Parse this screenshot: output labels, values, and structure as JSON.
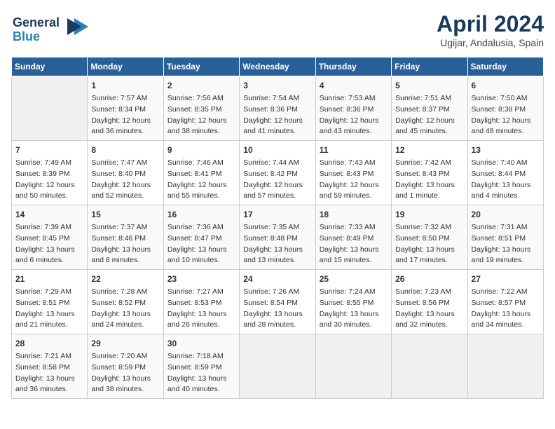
{
  "header": {
    "logo_line1": "General",
    "logo_line2": "Blue",
    "month_title": "April 2024",
    "location": "Ugijar, Andalusia, Spain"
  },
  "weekdays": [
    "Sunday",
    "Monday",
    "Tuesday",
    "Wednesday",
    "Thursday",
    "Friday",
    "Saturday"
  ],
  "weeks": [
    [
      {
        "day": "",
        "sunrise": "",
        "sunset": "",
        "daylight": ""
      },
      {
        "day": "1",
        "sunrise": "Sunrise: 7:57 AM",
        "sunset": "Sunset: 8:34 PM",
        "daylight": "Daylight: 12 hours and 36 minutes."
      },
      {
        "day": "2",
        "sunrise": "Sunrise: 7:56 AM",
        "sunset": "Sunset: 8:35 PM",
        "daylight": "Daylight: 12 hours and 38 minutes."
      },
      {
        "day": "3",
        "sunrise": "Sunrise: 7:54 AM",
        "sunset": "Sunset: 8:36 PM",
        "daylight": "Daylight: 12 hours and 41 minutes."
      },
      {
        "day": "4",
        "sunrise": "Sunrise: 7:53 AM",
        "sunset": "Sunset: 8:36 PM",
        "daylight": "Daylight: 12 hours and 43 minutes."
      },
      {
        "day": "5",
        "sunrise": "Sunrise: 7:51 AM",
        "sunset": "Sunset: 8:37 PM",
        "daylight": "Daylight: 12 hours and 45 minutes."
      },
      {
        "day": "6",
        "sunrise": "Sunrise: 7:50 AM",
        "sunset": "Sunset: 8:38 PM",
        "daylight": "Daylight: 12 hours and 48 minutes."
      }
    ],
    [
      {
        "day": "7",
        "sunrise": "Sunrise: 7:49 AM",
        "sunset": "Sunset: 8:39 PM",
        "daylight": "Daylight: 12 hours and 50 minutes."
      },
      {
        "day": "8",
        "sunrise": "Sunrise: 7:47 AM",
        "sunset": "Sunset: 8:40 PM",
        "daylight": "Daylight: 12 hours and 52 minutes."
      },
      {
        "day": "9",
        "sunrise": "Sunrise: 7:46 AM",
        "sunset": "Sunset: 8:41 PM",
        "daylight": "Daylight: 12 hours and 55 minutes."
      },
      {
        "day": "10",
        "sunrise": "Sunrise: 7:44 AM",
        "sunset": "Sunset: 8:42 PM",
        "daylight": "Daylight: 12 hours and 57 minutes."
      },
      {
        "day": "11",
        "sunrise": "Sunrise: 7:43 AM",
        "sunset": "Sunset: 8:43 PM",
        "daylight": "Daylight: 12 hours and 59 minutes."
      },
      {
        "day": "12",
        "sunrise": "Sunrise: 7:42 AM",
        "sunset": "Sunset: 8:43 PM",
        "daylight": "Daylight: 13 hours and 1 minute."
      },
      {
        "day": "13",
        "sunrise": "Sunrise: 7:40 AM",
        "sunset": "Sunset: 8:44 PM",
        "daylight": "Daylight: 13 hours and 4 minutes."
      }
    ],
    [
      {
        "day": "14",
        "sunrise": "Sunrise: 7:39 AM",
        "sunset": "Sunset: 8:45 PM",
        "daylight": "Daylight: 13 hours and 6 minutes."
      },
      {
        "day": "15",
        "sunrise": "Sunrise: 7:37 AM",
        "sunset": "Sunset: 8:46 PM",
        "daylight": "Daylight: 13 hours and 8 minutes."
      },
      {
        "day": "16",
        "sunrise": "Sunrise: 7:36 AM",
        "sunset": "Sunset: 8:47 PM",
        "daylight": "Daylight: 13 hours and 10 minutes."
      },
      {
        "day": "17",
        "sunrise": "Sunrise: 7:35 AM",
        "sunset": "Sunset: 8:48 PM",
        "daylight": "Daylight: 13 hours and 13 minutes."
      },
      {
        "day": "18",
        "sunrise": "Sunrise: 7:33 AM",
        "sunset": "Sunset: 8:49 PM",
        "daylight": "Daylight: 13 hours and 15 minutes."
      },
      {
        "day": "19",
        "sunrise": "Sunrise: 7:32 AM",
        "sunset": "Sunset: 8:50 PM",
        "daylight": "Daylight: 13 hours and 17 minutes."
      },
      {
        "day": "20",
        "sunrise": "Sunrise: 7:31 AM",
        "sunset": "Sunset: 8:51 PM",
        "daylight": "Daylight: 13 hours and 19 minutes."
      }
    ],
    [
      {
        "day": "21",
        "sunrise": "Sunrise: 7:29 AM",
        "sunset": "Sunset: 8:51 PM",
        "daylight": "Daylight: 13 hours and 21 minutes."
      },
      {
        "day": "22",
        "sunrise": "Sunrise: 7:28 AM",
        "sunset": "Sunset: 8:52 PM",
        "daylight": "Daylight: 13 hours and 24 minutes."
      },
      {
        "day": "23",
        "sunrise": "Sunrise: 7:27 AM",
        "sunset": "Sunset: 8:53 PM",
        "daylight": "Daylight: 13 hours and 26 minutes."
      },
      {
        "day": "24",
        "sunrise": "Sunrise: 7:26 AM",
        "sunset": "Sunset: 8:54 PM",
        "daylight": "Daylight: 13 hours and 28 minutes."
      },
      {
        "day": "25",
        "sunrise": "Sunrise: 7:24 AM",
        "sunset": "Sunset: 8:55 PM",
        "daylight": "Daylight: 13 hours and 30 minutes."
      },
      {
        "day": "26",
        "sunrise": "Sunrise: 7:23 AM",
        "sunset": "Sunset: 8:56 PM",
        "daylight": "Daylight: 13 hours and 32 minutes."
      },
      {
        "day": "27",
        "sunrise": "Sunrise: 7:22 AM",
        "sunset": "Sunset: 8:57 PM",
        "daylight": "Daylight: 13 hours and 34 minutes."
      }
    ],
    [
      {
        "day": "28",
        "sunrise": "Sunrise: 7:21 AM",
        "sunset": "Sunset: 8:58 PM",
        "daylight": "Daylight: 13 hours and 36 minutes."
      },
      {
        "day": "29",
        "sunrise": "Sunrise: 7:20 AM",
        "sunset": "Sunset: 8:59 PM",
        "daylight": "Daylight: 13 hours and 38 minutes."
      },
      {
        "day": "30",
        "sunrise": "Sunrise: 7:18 AM",
        "sunset": "Sunset: 8:59 PM",
        "daylight": "Daylight: 13 hours and 40 minutes."
      },
      {
        "day": "",
        "sunrise": "",
        "sunset": "",
        "daylight": ""
      },
      {
        "day": "",
        "sunrise": "",
        "sunset": "",
        "daylight": ""
      },
      {
        "day": "",
        "sunrise": "",
        "sunset": "",
        "daylight": ""
      },
      {
        "day": "",
        "sunrise": "",
        "sunset": "",
        "daylight": ""
      }
    ]
  ]
}
